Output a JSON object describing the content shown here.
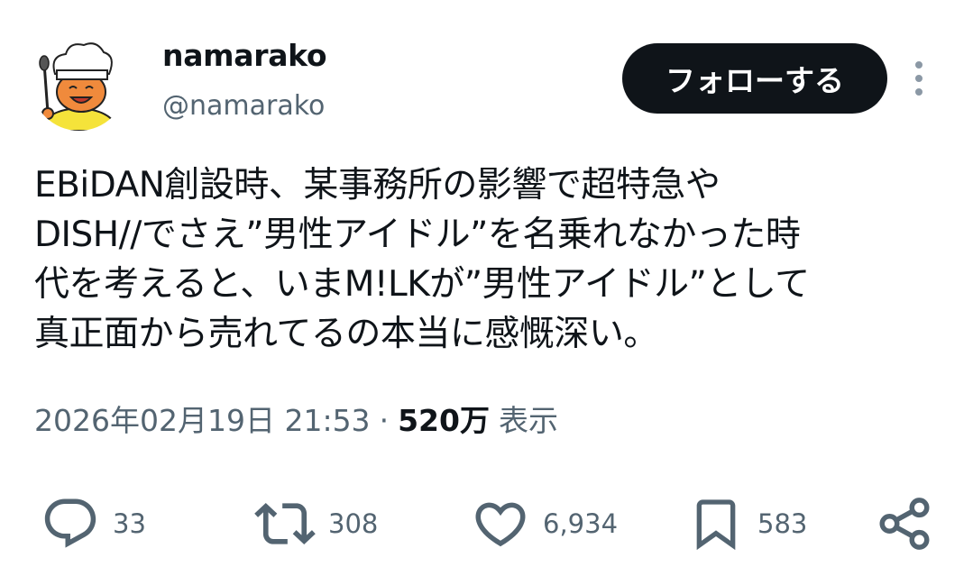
{
  "user": {
    "display_name": "namarako",
    "handle": "@namarako",
    "avatar_icon": "chef-avatar-icon"
  },
  "follow_button": {
    "label": "フォローする"
  },
  "more_icon": "more-vertical-icon",
  "tweet": {
    "lines": [
      "EBiDAN創設時、某事務所の影響で超特急や",
      "DISH//でさえ”男性アイドル”を名乗れなかった時",
      "代を考えると、いまM!LKが”男性アイドル”として",
      "真正面から売れてるの本当に感慨深い。"
    ]
  },
  "meta": {
    "timestamp": "2026年02月19日 21:53",
    "separator": "·",
    "views_count": "520万",
    "views_label": "表示"
  },
  "actions": {
    "reply": {
      "icon": "reply-icon",
      "count": "33"
    },
    "repost": {
      "icon": "repost-icon",
      "count": "308"
    },
    "like": {
      "icon": "like-icon",
      "count": "6,934"
    },
    "bookmark": {
      "icon": "bookmark-icon",
      "count": "583"
    },
    "share": {
      "icon": "share-icon"
    }
  },
  "colors": {
    "text": "#0f1419",
    "secondary": "#536471",
    "follow_bg": "#0f1419",
    "follow_text": "#ffffff"
  }
}
